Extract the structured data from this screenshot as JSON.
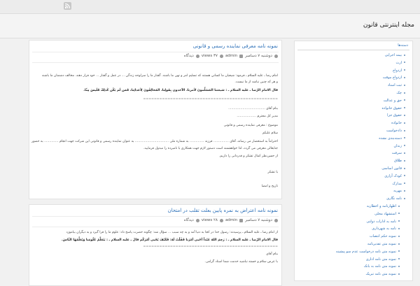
{
  "site": {
    "title": "مجله اینترنتی قانون",
    "rss_icon": "rss-icon"
  },
  "posts": [
    {
      "title": "نمونه نامه معرفی نماینده رسمی و قانونی",
      "meta": {
        "date": "دوشنبه ۷ دسامبر",
        "author": "admin",
        "views": "views ۳۷",
        "category": "دیدگاه"
      },
      "body": [
        "امام رضا ـ عليه السلام ـ فرمود: شيعيان ما کساني هستند که تسليم امر و نهي ما باشند. گفتار ما را سرلوحه زندگي ... در عمل و گفتار ... خود فرار دهند. مخالف دشمنان ما باشند",
        "و هر که چنين نباشد از ما نيست.",
        "قال الامام الرّضا ـ عليه السلام ـ : شيعتنا المُسَلِّمونَ لأمرنا، الآخذون بِقَولِنا، المُخالِفُونَ لِأعدائِنا، فَمَن لَم يَكُن كَذلِكَ فَلَيسَ مِنّا.",
        "==================================================",
        "بنام آقای ....................................",
        "مدیر کل محترم ...................",
        "موضوع : معرفی نماینده رسمی و قانونی",
        "سلام علیکم",
        "احتراماً به استحضار می رساند، آقای ............... فرزند .............. به شماره ملی ................................. به عنوان نماینده رسمی و قانونی این شرکت جهت انجام .............. به حضور",
        "جنابعالی معرفی می گردد، لذا خواهشمند است دستور لازم جهت همکاری با نامبرده را مبذول فرمایید.",
        "از حسن‌نظر کمال تشکر و قدردانی را داریم.",
        "با تشکر",
        "تاریخ و امضا"
      ]
    },
    {
      "title": "نمونه نامه اعتراض به نمره پایین بعلت تقلب در امتحان",
      "meta": {
        "date": "دوشنبه ۷ دسامبر",
        "author": "admin",
        "views": "views ۲۸",
        "category": "دیدگاه"
      },
      "body": [
        "از امام رضا ـ عليه السلام ـ پرسيدند: رسول خدا در کجا به دنيا آمد و به چه سبب ... سؤال شد: چگونه حضرت پاسخ داد: علوم ما را فرا گيرد و به ديگران بیاموزد",
        "قال الامام الرّضا ـ عليه السلام ـ : رَحِمَ اللهُ عَبْداً أحْيى أمْرَنا فَقُلْتُ لَهُ: فَكَيْفَ يُحْيى أمْرَكُم قالَ ـ عليه السلام ـ : يَتَعَلَّمُ عُلُومَنا وَيُعَلِّمُهَا النّاسَ.",
        "==================================================",
        "بنام آقای",
        "با عرض سلام و خسته نباشید خدمت شما استاد گرامی."
      ]
    }
  ],
  "sidebar": {
    "title": "دسته‌ها",
    "items": [
      {
        "label": "بیمه اجرایی",
        "child": false
      },
      {
        "label": "ارث",
        "child": false
      },
      {
        "label": "ازدواج",
        "child": false
      },
      {
        "label": "ازدواج موقت",
        "child": false
      },
      {
        "label": "ثبت اسناد",
        "child": false
      },
      {
        "label": "چک",
        "child": false
      },
      {
        "label": "حق و عدالت",
        "child": false
      },
      {
        "label": "حقوق خانواده",
        "child": false
      },
      {
        "label": "حقوق جزا",
        "child": false
      },
      {
        "label": "خانواده",
        "child": false
      },
      {
        "label": "دادخواست",
        "child": false
      },
      {
        "label": "دسته‌بندی نشده",
        "child": false
      },
      {
        "label": "زندان",
        "child": false
      },
      {
        "label": "سرقت",
        "child": false
      },
      {
        "label": "طلاق",
        "child": false
      },
      {
        "label": "قانون اساسی",
        "child": false
      },
      {
        "label": "کودک آزاری",
        "child": false
      },
      {
        "label": "مدارک",
        "child": false
      },
      {
        "label": "مهریه",
        "child": false
      },
      {
        "label": "نامه نگاری",
        "child": false
      },
      {
        "label": "اظهارنامه و اخطاریه",
        "child": true
      },
      {
        "label": "استشهاد محلی",
        "child": true
      },
      {
        "label": "نامه به ادارات دولتی",
        "child": true
      },
      {
        "label": "نامه به شهرداری",
        "child": true
      },
      {
        "label": "نمونه حکم انتصاب",
        "child": true
      },
      {
        "label": "نمونه متن تقدیرنامه",
        "child": true
      },
      {
        "label": "نمونه متن نامه درخواست عدم سو پیشینه",
        "child": true
      },
      {
        "label": "نمونه متن نامه اداری",
        "child": true
      },
      {
        "label": "نمونه متن نامه به بانک",
        "child": true
      },
      {
        "label": "نمونه متن نامه تبریک",
        "child": true
      }
    ]
  }
}
